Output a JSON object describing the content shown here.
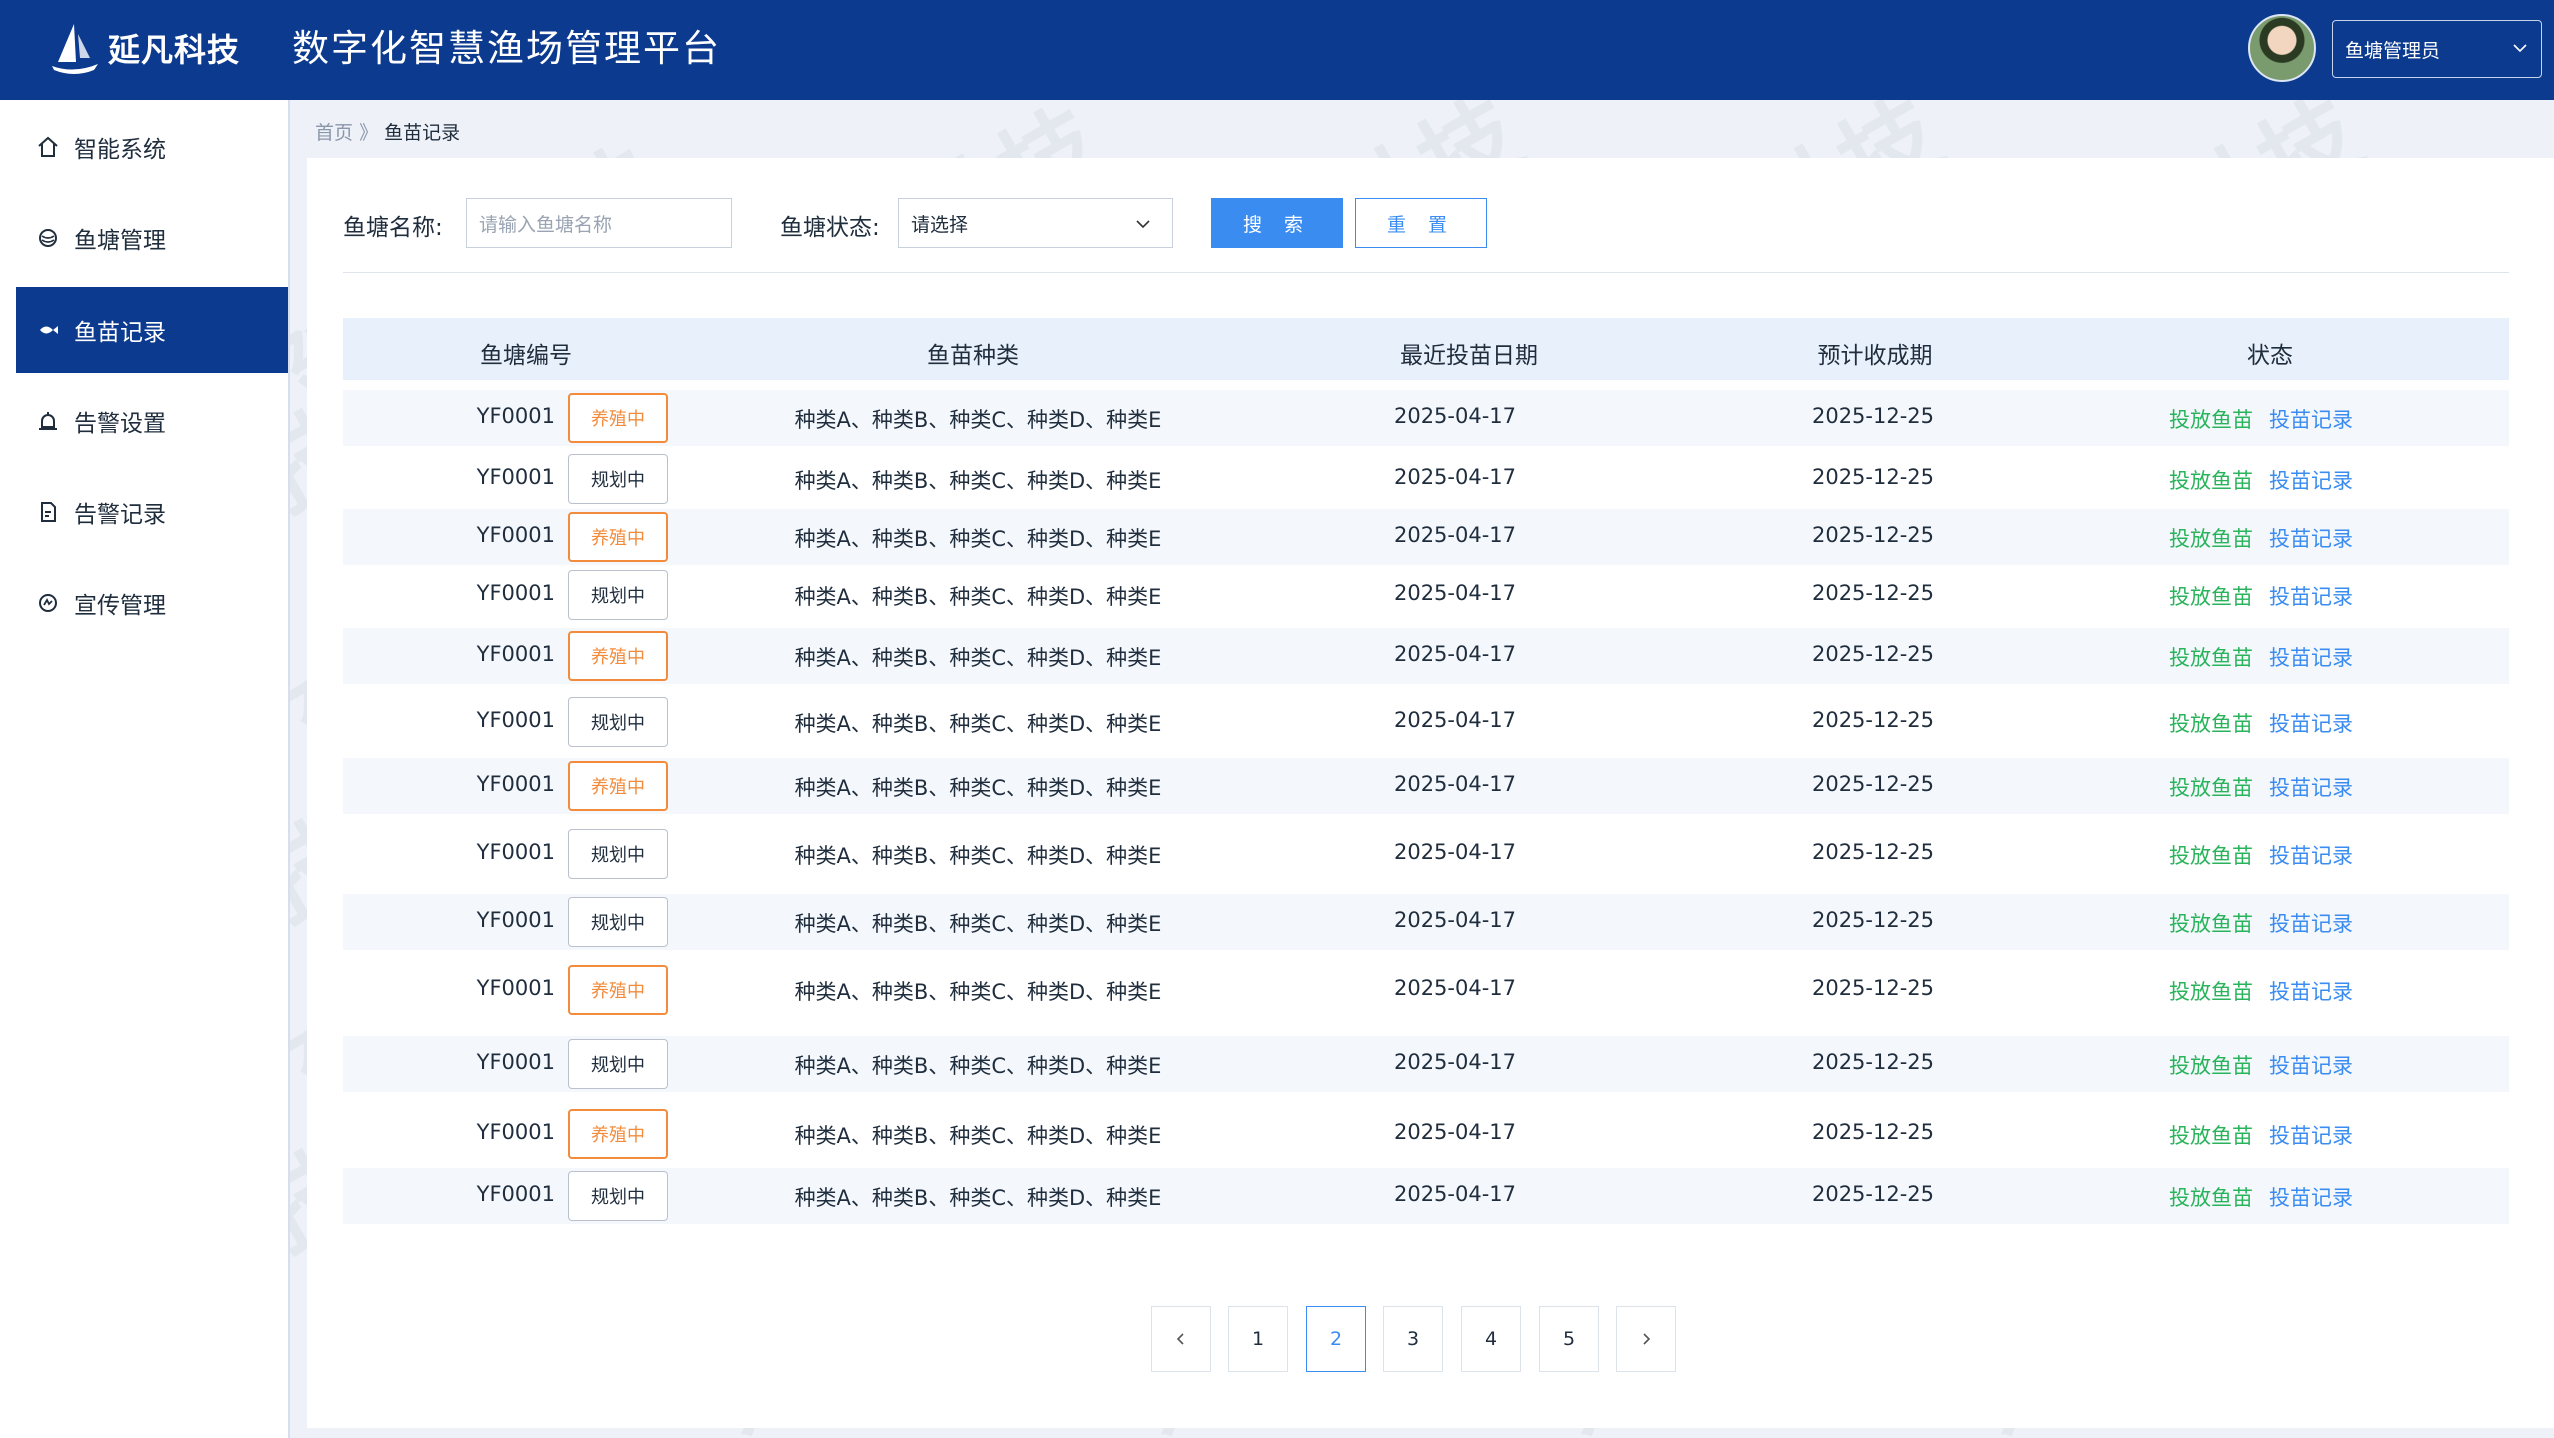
{
  "header": {
    "logo_text": "延凡科技",
    "app_title": "数字化智慧渔场管理平台",
    "user_role": "鱼塘管理员"
  },
  "sidebar": {
    "items": [
      {
        "label": "智能系统",
        "icon": "home-icon"
      },
      {
        "label": "鱼塘管理",
        "icon": "pond-icon"
      },
      {
        "label": "鱼苗记录",
        "icon": "fish-icon",
        "active": true
      },
      {
        "label": "告警设置",
        "icon": "alarm-icon"
      },
      {
        "label": "告警记录",
        "icon": "report-icon"
      },
      {
        "label": "宣传管理",
        "icon": "megaphone-icon"
      }
    ]
  },
  "breadcrumb": {
    "home": "首页",
    "separator": "》",
    "current": "鱼苗记录"
  },
  "filters": {
    "pond_name_label": "鱼塘名称:",
    "pond_name_placeholder": "请输入鱼塘名称",
    "pond_status_label": "鱼塘状态:",
    "pond_status_value": "请选择",
    "search_label": "搜 索",
    "reset_label": "重 置"
  },
  "table": {
    "columns": [
      "鱼塘编号",
      "鱼苗种类",
      "最近投苗日期",
      "预计收成期",
      "状态"
    ],
    "rows": [
      {
        "code": "YF0001",
        "tag": "养殖中",
        "species": "种类A、种类B、种类C、种类D、种类E",
        "date": "2025-04-17",
        "harvest": "2025-12-25",
        "action1": "投放鱼苗",
        "action2": "投苗记录"
      },
      {
        "code": "YF0001",
        "tag": "规划中",
        "species": "种类A、种类B、种类C、种类D、种类E",
        "date": "2025-04-17",
        "harvest": "2025-12-25",
        "action1": "投放鱼苗",
        "action2": "投苗记录"
      },
      {
        "code": "YF0001",
        "tag": "养殖中",
        "species": "种类A、种类B、种类C、种类D、种类E",
        "date": "2025-04-17",
        "harvest": "2025-12-25",
        "action1": "投放鱼苗",
        "action2": "投苗记录"
      },
      {
        "code": "YF0001",
        "tag": "规划中",
        "species": "种类A、种类B、种类C、种类D、种类E",
        "date": "2025-04-17",
        "harvest": "2025-12-25",
        "action1": "投放鱼苗",
        "action2": "投苗记录"
      },
      {
        "code": "YF0001",
        "tag": "养殖中",
        "species": "种类A、种类B、种类C、种类D、种类E",
        "date": "2025-04-17",
        "harvest": "2025-12-25",
        "action1": "投放鱼苗",
        "action2": "投苗记录"
      },
      {
        "code": "YF0001",
        "tag": "规划中",
        "species": "种类A、种类B、种类C、种类D、种类E",
        "date": "2025-04-17",
        "harvest": "2025-12-25",
        "action1": "投放鱼苗",
        "action2": "投苗记录"
      },
      {
        "code": "YF0001",
        "tag": "养殖中",
        "species": "种类A、种类B、种类C、种类D、种类E",
        "date": "2025-04-17",
        "harvest": "2025-12-25",
        "action1": "投放鱼苗",
        "action2": "投苗记录"
      },
      {
        "code": "YF0001",
        "tag": "规划中",
        "species": "种类A、种类B、种类C、种类D、种类E",
        "date": "2025-04-17",
        "harvest": "2025-12-25",
        "action1": "投放鱼苗",
        "action2": "投苗记录"
      },
      {
        "code": "YF0001",
        "tag": "规划中",
        "species": "种类A、种类B、种类C、种类D、种类E",
        "date": "2025-04-17",
        "harvest": "2025-12-25",
        "action1": "投放鱼苗",
        "action2": "投苗记录"
      },
      {
        "code": "YF0001",
        "tag": "养殖中",
        "species": "种类A、种类B、种类C、种类D、种类E",
        "date": "2025-04-17",
        "harvest": "2025-12-25",
        "action1": "投放鱼苗",
        "action2": "投苗记录"
      },
      {
        "code": "YF0001",
        "tag": "规划中",
        "species": "种类A、种类B、种类C、种类D、种类E",
        "date": "2025-04-17",
        "harvest": "2025-12-25",
        "action1": "投放鱼苗",
        "action2": "投苗记录"
      },
      {
        "code": "YF0001",
        "tag": "养殖中",
        "species": "种类A、种类B、种类C、种类D、种类E",
        "date": "2025-04-17",
        "harvest": "2025-12-25",
        "action1": "投放鱼苗",
        "action2": "投苗记录"
      },
      {
        "code": "YF0001",
        "tag": "规划中",
        "species": "种类A、种类B、种类C、种类D、种类E",
        "date": "2025-04-17",
        "harvest": "2025-12-25",
        "action1": "投放鱼苗",
        "action2": "投苗记录"
      }
    ]
  },
  "pagination": {
    "pages": [
      "1",
      "2",
      "3",
      "4",
      "5"
    ],
    "current": "2"
  },
  "watermark": "延凡科技",
  "colors": {
    "header_bg": "#0b3a8f",
    "primary": "#3b8cf1",
    "green": "#29b35b",
    "orange": "#f28c3c"
  }
}
